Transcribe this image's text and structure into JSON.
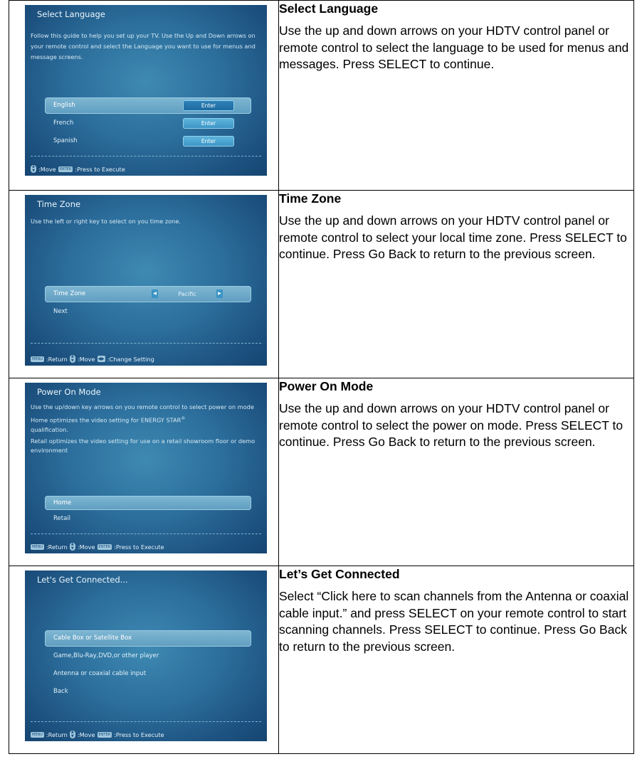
{
  "sections": [
    {
      "title": "Select Language",
      "body": "Use the up and down arrows on your HDTV control panel or remote control to select the language to be used for menus and messages. Press SELECT to continue.",
      "screen": {
        "title": "Select Language",
        "description": "Follow this guide to help you set up your TV. Use the Up and Down arrows on your remote control and select the Language you want to use for menus and message screens.",
        "items": [
          {
            "label": "English",
            "button": "Enter"
          },
          {
            "label": "French",
            "button": "Enter"
          },
          {
            "label": "Spanish",
            "button": "Enter"
          }
        ],
        "footer": {
          "move": ":Move",
          "enter_key": "ENTER",
          "execute": ":Press to Execute"
        }
      }
    },
    {
      "title": "Time Zone",
      "body": "Use the up and down arrows on your HDTV control panel or remote control to select your local time zone. Press SELECT to continue. Press Go Back to return to the previous screen.",
      "screen": {
        "title": "Time Zone",
        "description": "Use the left or right key to select on you time zone.",
        "items": [
          {
            "label": "Time Zone",
            "value": "Pacific"
          },
          {
            "label": "Next"
          }
        ],
        "footer": {
          "menu_key": "MENU",
          "return": ":Return",
          "move": ":Move",
          "change": ":Change Setting"
        }
      }
    },
    {
      "title": "Power On Mode",
      "body": "Use the up and down arrows on your HDTV control panel or remote control to select the power on mode. Press SELECT to continue. Press Go Back to return to the previous screen.",
      "screen": {
        "title": "Power On Mode",
        "desc1": "Use the up/down key arrows on you remote control to select power on mode",
        "desc2": "Home optimizes the video setting for ENERGY STAR",
        "desc2_sup": "®",
        "desc2_tail": "qualification.",
        "desc3": "Retail optimizes the video setting for use on a retail showroom floor or demo environment",
        "items": [
          {
            "label": "Home"
          },
          {
            "label": "Retail"
          }
        ],
        "footer": {
          "menu_key": "MENU",
          "return": ":Return",
          "move": ":Move",
          "enter_key": "ENTER",
          "execute": ":Press to Execute"
        }
      }
    },
    {
      "title": "Let’s Get Connected",
      "body": "Select “Click here to scan channels from the Antenna or coaxial cable input.” and press SELECT on your remote control to start scanning channels. Press SELECT to continue. Press Go Back to return to the previous screen.",
      "screen": {
        "title": "Let's Get Connected...",
        "items": [
          {
            "label": "Cable Box or Satellite Box"
          },
          {
            "label": "Game,Blu-Ray,DVD,or other player"
          },
          {
            "label": "Antenna or coaxial cable input"
          },
          {
            "label": "Back"
          }
        ],
        "footer": {
          "menu_key": "MENU",
          "return": ":Return",
          "move": ":Move",
          "enter_key": "ENTER",
          "execute": ":Press to Execute"
        }
      }
    }
  ]
}
